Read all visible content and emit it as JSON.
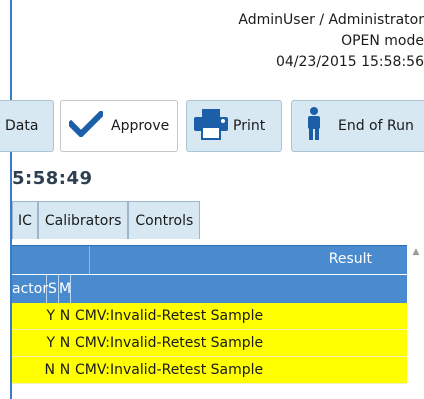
{
  "header": {
    "user": "AdminUser / Administrator",
    "mode": "OPEN mode",
    "datetime": "04/23/2015 15:58:56"
  },
  "toolbar": {
    "data_label": "Data",
    "approve_label": "Approve",
    "print_label": "Print",
    "end_of_run_label": "End of Run"
  },
  "time": "5:58:49",
  "tabs": [
    {
      "label": "IC"
    },
    {
      "label": "Calibrators"
    },
    {
      "label": "Controls"
    }
  ],
  "grid": {
    "result_header": "Result",
    "columns": [
      "actor",
      "S",
      "M"
    ],
    "rows": [
      {
        "s": "Y",
        "m": "N",
        "result": "CMV:Invalid-Retest Sample"
      },
      {
        "s": "Y",
        "m": "N",
        "result": "CMV:Invalid-Retest Sample"
      },
      {
        "s": "N",
        "m": "N",
        "result": "CMV:Invalid-Retest Sample"
      }
    ]
  },
  "colors": {
    "accent": "#4a8bd0",
    "button_bg": "#d7e8f3",
    "highlight_row": "#ffff00",
    "icon_blue": "#1a5fa8"
  },
  "icons": [
    "checkmark-icon",
    "printer-icon",
    "person-icon",
    "scroll-up-icon"
  ]
}
